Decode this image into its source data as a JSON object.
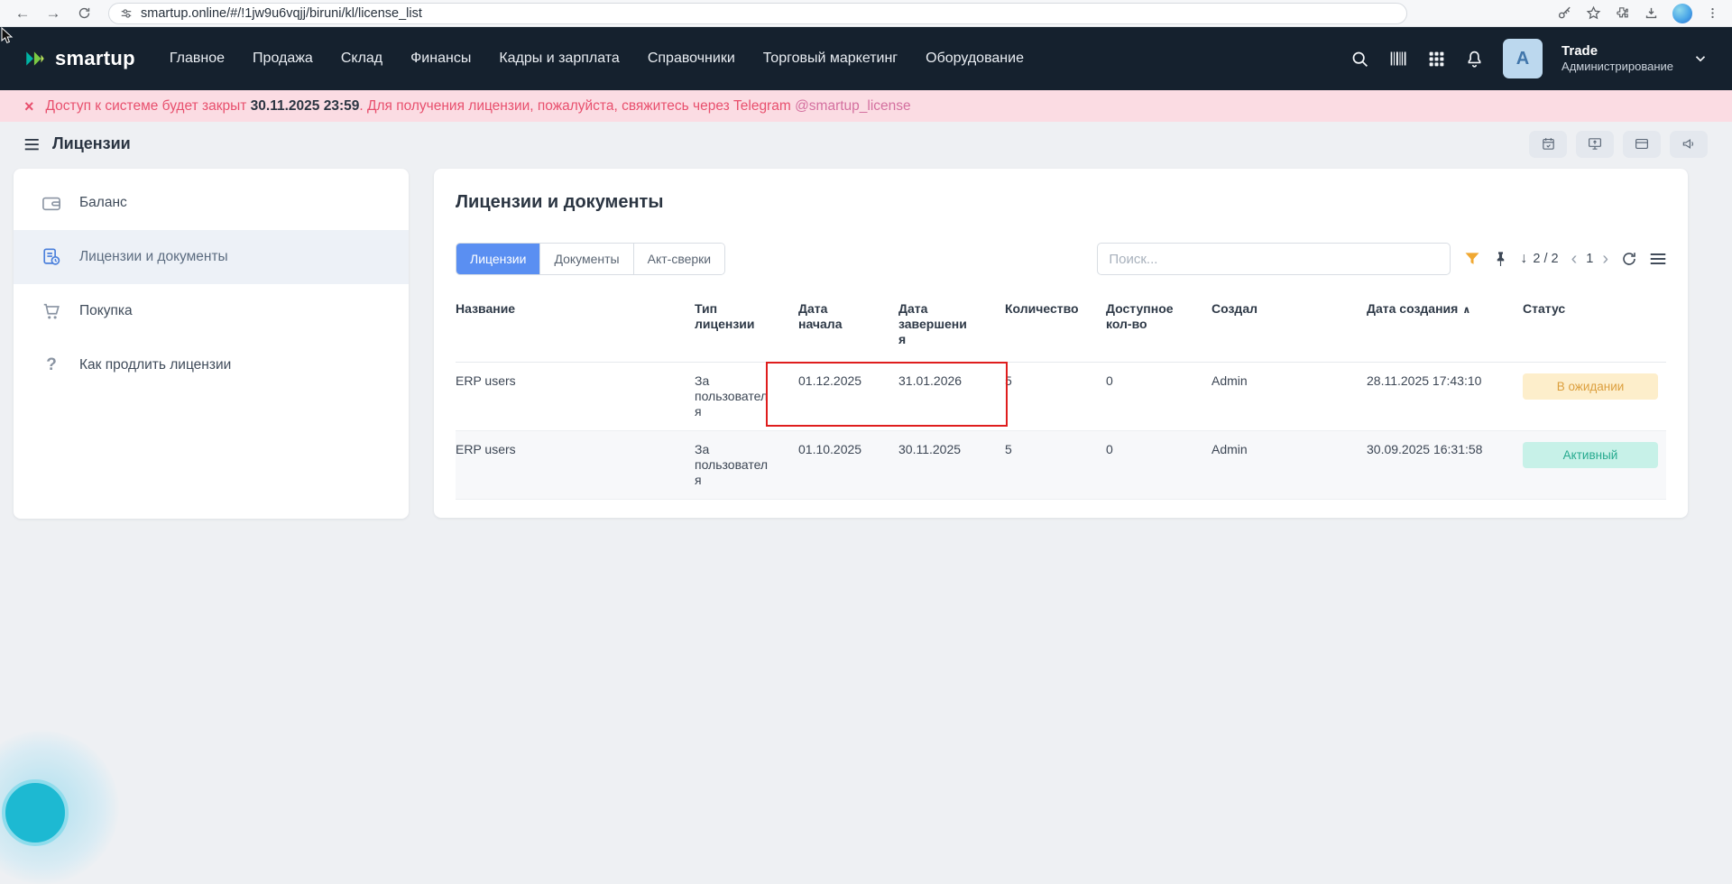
{
  "browser": {
    "url": "smartup.online/#/!1jw9u6vqjj/biruni/kl/license_list"
  },
  "header": {
    "logo_text": "smartup",
    "nav": [
      {
        "label": "Главное"
      },
      {
        "label": "Продажа"
      },
      {
        "label": "Склад"
      },
      {
        "label": "Финансы"
      },
      {
        "label": "Кадры и зарплата"
      },
      {
        "label": "Справочники"
      },
      {
        "label": "Торговый маркетинг"
      },
      {
        "label": "Оборудование"
      }
    ],
    "account": {
      "avatar_letter": "A",
      "name": "Trade",
      "role": "Администрирование"
    }
  },
  "banner": {
    "close_glyph": "×",
    "text_prefix": "Доступ к системе будет закрыт ",
    "text_bold": "30.11.2025 23:59",
    "text_middle": ". Для получения лицензии, пожалуйста, свяжитесь через Telegram ",
    "link": "@smartup_license"
  },
  "page": {
    "title": "Лицензии"
  },
  "sidebar": {
    "items": [
      {
        "label": "Баланс",
        "active": false
      },
      {
        "label": "Лицензии и документы",
        "active": true
      },
      {
        "label": "Покупка",
        "active": false
      },
      {
        "label": "Как продлить лицензии",
        "active": false
      }
    ]
  },
  "main": {
    "title": "Лицензии и документы",
    "tabs": [
      {
        "label": "Лицензии",
        "active": true
      },
      {
        "label": "Документы",
        "active": false
      },
      {
        "label": "Акт-сверки",
        "active": false
      }
    ],
    "search_placeholder": "Поиск...",
    "sort_arrow": "↓",
    "counter": "2 / 2",
    "pager": {
      "prev": "‹",
      "page": "1",
      "next": "›"
    }
  },
  "table": {
    "headers": [
      "Название",
      "Тип лицензии",
      "Дата начала",
      "Дата завершения",
      "Количество",
      "Доступное кол-во",
      "Создал",
      "Дата создания",
      "Статус"
    ],
    "sort_caret": "∧",
    "rows": [
      {
        "name": "ERP users",
        "license_type": "За пользователя",
        "date_start": "01.12.2025",
        "date_end": "31.01.2026",
        "quantity": "5",
        "available": "0",
        "created_by": "Admin",
        "created_at": "28.11.2025 17:43:10",
        "status": "В ожидании",
        "status_kind": "pending"
      },
      {
        "name": "ERP users",
        "license_type": "За пользователя",
        "date_start": "01.10.2025",
        "date_end": "30.11.2025",
        "quantity": "5",
        "available": "0",
        "created_by": "Admin",
        "created_at": "30.09.2025 16:31:58",
        "status": "Активный",
        "status_kind": "active"
      }
    ]
  },
  "colors": {
    "nav_bg": "#15212e",
    "accent_blue": "#5a8ff2",
    "banner_bg": "#fbdce3",
    "banner_text": "#e8506e",
    "filter_orange": "#f0a832",
    "status_pending_bg": "#fdeecb",
    "status_pending_text": "#dc9f3e",
    "status_active_bg": "#c7f1e8",
    "status_active_text": "#27aa8f",
    "annotation_red": "#df1d1d"
  }
}
